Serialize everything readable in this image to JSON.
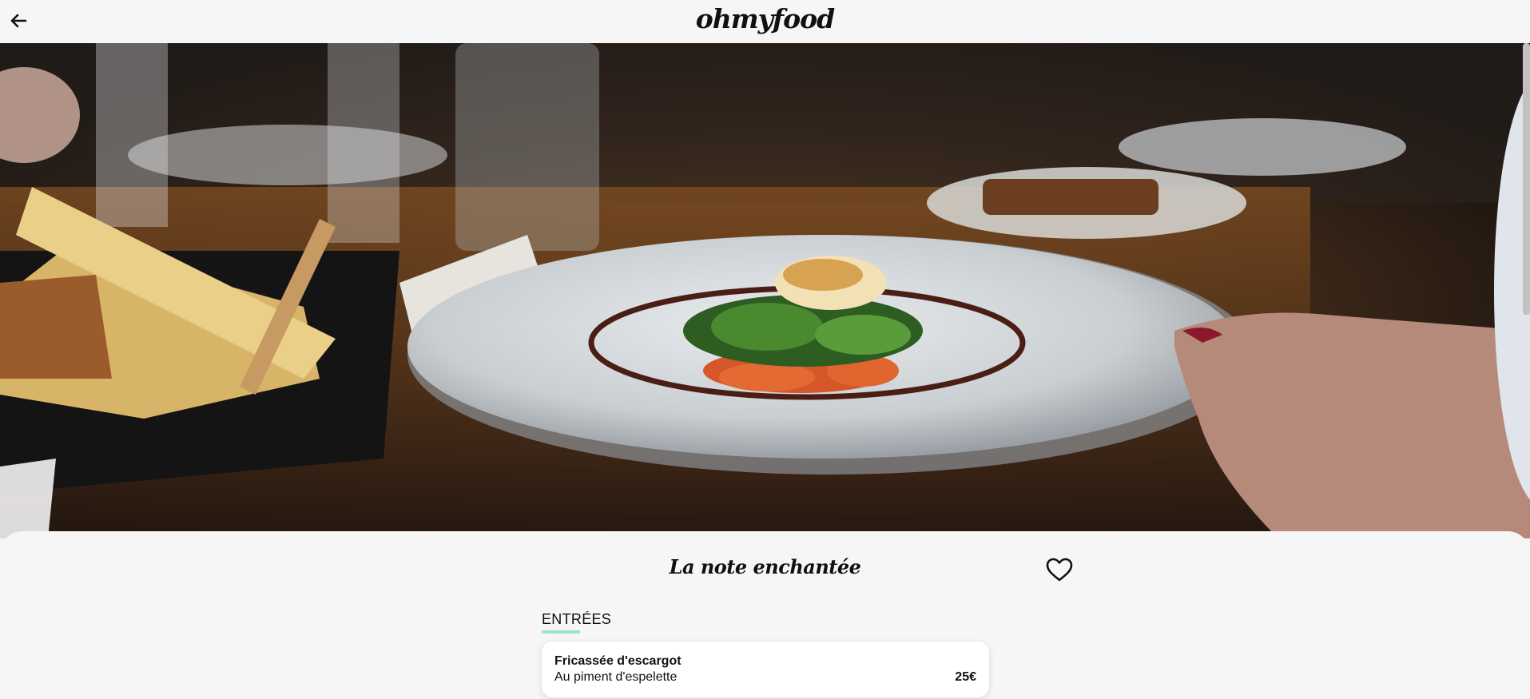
{
  "header": {
    "back_icon": "arrow-left-icon",
    "logo": "ohmyfood"
  },
  "hero": {
    "image": "plated-salmon-dish-photo"
  },
  "restaurant": {
    "name": "La note enchantée",
    "favorite_icon": "heart-outline-icon"
  },
  "menu": {
    "sections": [
      {
        "title": "ENTRÉES",
        "accent_color": "#99e2d0",
        "items": [
          {
            "name": "Fricassée d'escargot",
            "description": "Au piment d'espelette",
            "price": "25€"
          }
        ]
      }
    ]
  }
}
